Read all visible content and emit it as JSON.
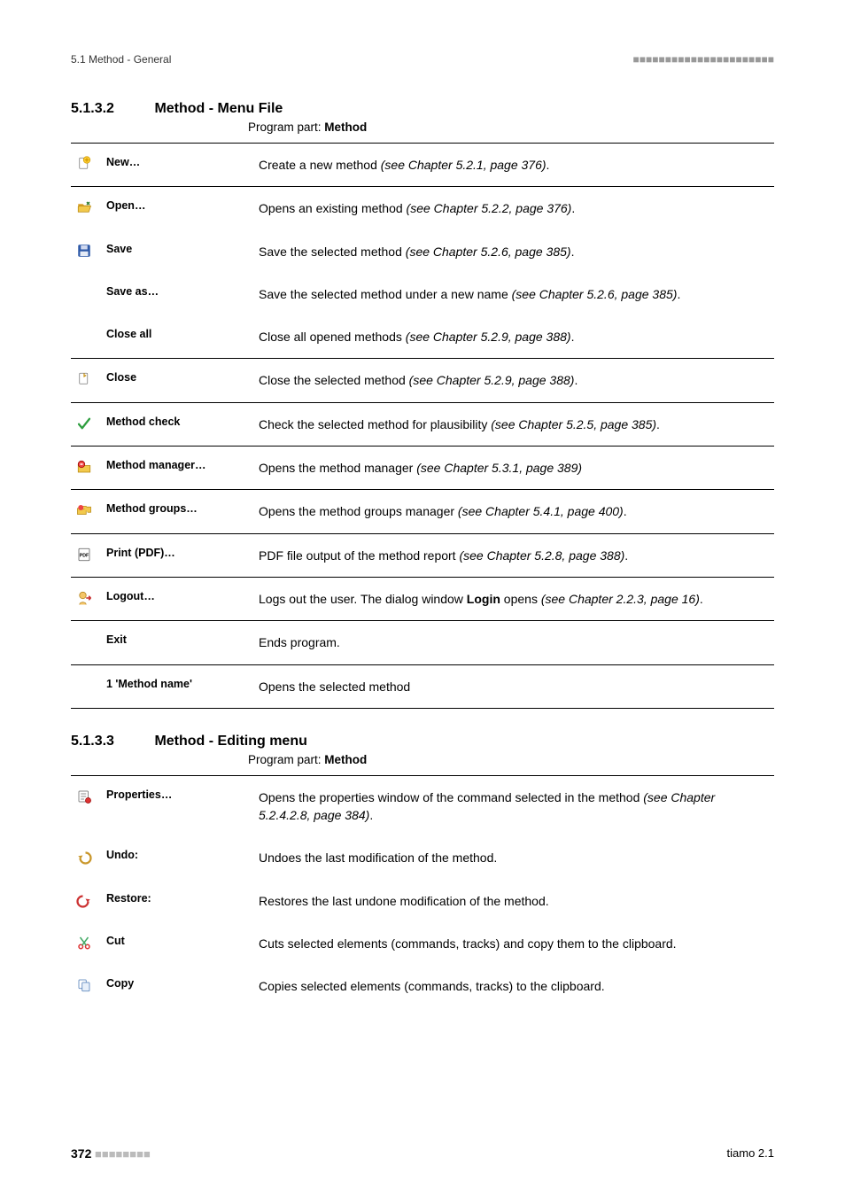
{
  "header": {
    "left": "5.1 Method - General",
    "right": "■■■■■■■■■■■■■■■■■■■■■■"
  },
  "section_file": {
    "number": "5.1.3.2",
    "title": "Method - Menu File",
    "program_part_prefix": "Program part: ",
    "program_part": "Method",
    "rows": [
      {
        "icon": "new",
        "label": "New…",
        "desc_pre": "Create a new method ",
        "desc_ref": "(see Chapter 5.2.1, page 376)",
        "desc_post": "."
      },
      {
        "icon": "open",
        "label": "Open…",
        "desc_pre": "Opens an existing method ",
        "desc_ref": "(see Chapter 5.2.2, page 376)",
        "desc_post": ".",
        "rule": true
      },
      {
        "icon": "save",
        "label": "Save",
        "desc_pre": "Save the selected method ",
        "desc_ref": "(see Chapter 5.2.6, page 385)",
        "desc_post": "."
      },
      {
        "icon": "",
        "label": "Save as…",
        "desc_pre": "Save the selected method under a new name ",
        "desc_ref": "(see Chapter 5.2.6, page 385)",
        "desc_post": "."
      },
      {
        "icon": "",
        "label": "Close all",
        "desc_pre": "Close all opened methods ",
        "desc_ref": "(see Chapter 5.2.9, page 388)",
        "desc_post": "."
      },
      {
        "icon": "close",
        "label": "Close",
        "desc_pre": "Close the selected method ",
        "desc_ref": "(see Chapter 5.2.9, page 388)",
        "desc_post": ".",
        "rule": true
      },
      {
        "icon": "check",
        "label": "Method check",
        "desc_pre": "Check the selected method for plausibility ",
        "desc_ref": "(see Chapter 5.2.5, page 385)",
        "desc_post": ".",
        "rule": true
      },
      {
        "icon": "manager",
        "label": "Method manager…",
        "desc_pre": "Opens the method manager ",
        "desc_ref": "(see Chapter 5.3.1, page 389)",
        "desc_post": "",
        "rule": true
      },
      {
        "icon": "groups",
        "label": "Method groups…",
        "desc_pre": "Opens the method groups manager ",
        "desc_ref": "(see Chapter 5.4.1, page 400)",
        "desc_post": ".",
        "rule": true
      },
      {
        "icon": "pdf",
        "label": "Print (PDF)…",
        "desc_pre": "PDF file output of the method report ",
        "desc_ref": "(see Chapter 5.2.8, page 388)",
        "desc_post": ".",
        "rule": true
      },
      {
        "icon": "logout",
        "label": "Logout…",
        "desc_pre": "Logs out the user. The dialog window ",
        "desc_bold": "Login",
        "desc_mid": " opens ",
        "desc_ref": "(see Chapter 2.2.3, page 16)",
        "desc_post": ".",
        "rule": true
      },
      {
        "icon": "",
        "label": "Exit",
        "desc_plain": "Ends program.",
        "rule": true
      },
      {
        "icon": "",
        "label": "1 'Method name'",
        "desc_plain": "Opens the selected method",
        "rule": true,
        "last": true
      }
    ]
  },
  "section_edit": {
    "number": "5.1.3.3",
    "title": "Method - Editing menu",
    "program_part_prefix": "Program part: ",
    "program_part": "Method",
    "rows": [
      {
        "icon": "properties",
        "label": "Properties…",
        "desc_pre": "Opens the properties window of the command selected in the method ",
        "desc_ref": "(see Chapter 5.2.4.2.8, page 384)",
        "desc_post": "."
      },
      {
        "icon": "undo",
        "label": "Undo:",
        "desc_plain": "Undoes the last modification of the method."
      },
      {
        "icon": "restore",
        "label": "Restore:",
        "desc_plain": "Restores the last undone modification of the method."
      },
      {
        "icon": "cut",
        "label": "Cut",
        "desc_plain": "Cuts selected elements (commands, tracks) and copy them to the clipboard."
      },
      {
        "icon": "copy",
        "label": "Copy",
        "desc_plain": "Copies selected elements (commands, tracks) to the clipboard."
      }
    ]
  },
  "footer": {
    "page": "372",
    "dashes": "■■■■■■■■",
    "right": "tiamo 2.1"
  },
  "icons": {
    "new": "<svg class='ic' viewBox='0 0 24 24'><rect x='5' y='3' width='12' height='16' rx='1' fill='#fff' stroke='#777'/><circle cx='16' cy='6' r='5' fill='#ffcc33' stroke='#c90'/><path d='M16 3v6M13 6h6' stroke='#c90' stroke-width='1.5'/></svg>",
    "open": "<svg class='ic' viewBox='0 0 24 24'><path d='M3 7h7l2 2h9v2H3z' fill='#d8a028'/><path d='M3 11l2-1h17l-3 9H3z' fill='#f2c94c' stroke='#b8860b'/><path d='M16 4l4 4M20 4l-4 4' stroke='#2e7d32' stroke-width='2' fill='none'/></svg>",
    "save": "<svg class='ic' viewBox='0 0 24 24'><rect x='3' y='3' width='18' height='18' rx='2' fill='#2f5aa8'/><rect x='7' y='4' width='10' height='6' fill='#cfd8ef'/><rect x='6' y='13' width='12' height='7' fill='#e6ecf7'/></svg>",
    "close": "<svg class='ic' viewBox='0 0 24 24'><rect x='5' y='3' width='12' height='16' rx='1' fill='#fff' stroke='#777'/><path d='M12 3v5l3-2' fill='none' stroke='#c48a00' stroke-width='1.5'/></svg>",
    "check": "<svg class='ic' viewBox='0 0 24 24'><path d='M4 13l5 6L20 5' fill='none' stroke='#2e9e3f' stroke-width='3' stroke-linecap='round' stroke-linejoin='round'/></svg>",
    "manager": "<svg class='ic' viewBox='0 0 24 24'><path d='M3 8h7l2 2h9v10H3z' fill='#f2c94c' stroke='#b8860b'/><circle cx='8' cy='8' r='5' fill='#e44' stroke='#900'/><rect x='6' y='7' width='4' height='2' fill='#fff'/></svg>",
    "groups": "<svg class='ic' viewBox='0 0 24 24'><path d='M2 9h6l1 1h6v8H2z' fill='#f2c94c' stroke='#b8860b'/><path d='M9 6h6l1 1h6v8h-5' fill='#f2c94c' stroke='#b8860b'/><circle cx='7' cy='8' r='4' fill='#e44'/></svg>",
    "pdf": "<svg class='ic' viewBox='0 0 24 24'><rect x='4' y='3' width='16' height='18' rx='1' fill='#fff' stroke='#555'/><text x='12' y='15' font-size='7' text-anchor='middle' font-family='Arial' fill='#000' font-weight='bold'>PDF</text></svg>",
    "logout": "<svg class='ic' viewBox='0 0 24 24'><circle cx='10' cy='8' r='5' fill='#f4c568' stroke='#b07d12'/><path d='M5 22c0-5 10-5 10 0' fill='#f4c568' stroke='#b07d12'/><path d='M15 12h7m0 0l-3-3m3 3l-3 3' stroke='#c62828' stroke-width='2' fill='none'/></svg>",
    "properties": "<svg class='ic' viewBox='0 0 24 24'><rect x='4' y='4' width='14' height='16' rx='1' fill='#fff' stroke='#666'/><path d='M7 8h8M7 12h8M7 16h5' stroke='#666'/><circle cx='18' cy='18' r='4' fill='#d33' stroke='#900'/></svg>",
    "undo": "<svg class='ic' viewBox='0 0 24 24'><path d='M14 6a8 8 0 1 1-8 8' fill='none' stroke='#c9972b' stroke-width='3'/><path d='M3 11l4 4 3-5z' fill='#c9972b'/></svg>",
    "restore": "<svg class='ic' viewBox='0 0 24 24'><path d='M10 6a8 8 0 1 0 8 8' fill='none' stroke='#c33' stroke-width='3'/><path d='M21 11l-4 4-3-5z' fill='#c33'/></svg>",
    "cut": "<svg class='ic' viewBox='0 0 24 24'><circle cx='7' cy='18' r='3' fill='none' stroke='#d33' stroke-width='2'/><circle cx='17' cy='18' r='3' fill='none' stroke='#d33' stroke-width='2'/><path d='M9 16L18 4M15 16L6 4' stroke='#4a6' stroke-width='2'/></svg>",
    "copy": "<svg class='ic' viewBox='0 0 24 24'><rect x='4' y='4' width='11' height='13' rx='1' fill='#fff' stroke='#4a78b5'/><rect x='9' y='8' width='11' height='13' rx='1' fill='#e8f0fa' stroke='#4a78b5'/></svg>"
  }
}
